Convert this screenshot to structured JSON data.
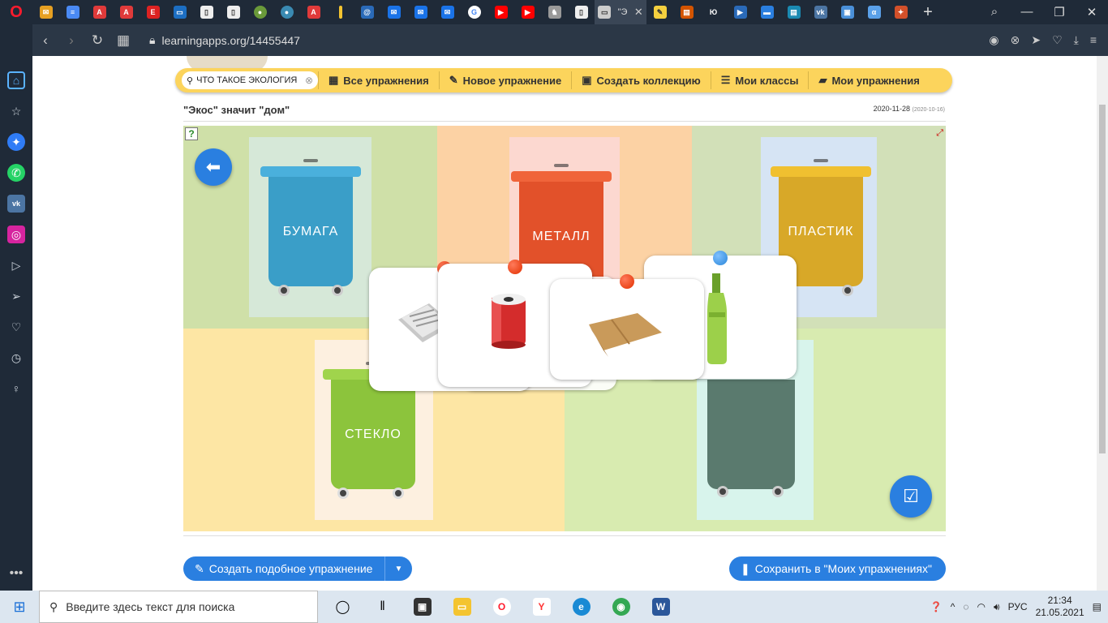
{
  "browser": {
    "active_tab_title": "\"Э",
    "new_tab": "+",
    "url": "learningapps.org/14455447",
    "tab_icons": [
      "opera-mail",
      "docs",
      "pdf",
      "pdf",
      "eduneo",
      "monitor",
      "file",
      "file",
      "globe",
      "globe",
      "pdf",
      "yellow-bar",
      "at",
      "mail",
      "mail",
      "mail",
      "google",
      "youtube",
      "youtube",
      "animal",
      "file"
    ],
    "after_tab_icons": [
      "note",
      "book",
      "lj",
      "media",
      "chat",
      "book",
      "vk",
      "image",
      "alpha",
      "gift"
    ]
  },
  "toolbar": {
    "search_value": "что такое экология",
    "items": [
      "Все упражнения",
      "Новое упражнение",
      "Создать коллекцию",
      "Мои классы",
      "Мои упражнения"
    ]
  },
  "exercise": {
    "title": "\"Экос\" значит \"дом\"",
    "date": "2020-11-28",
    "date_small": "(2020-10-16)",
    "bins": {
      "paper": "БУМАГА",
      "metal": "МЕТАЛЛ",
      "plastic": "ПЛАСТИК",
      "glass": "СТЕКЛО"
    }
  },
  "buttons": {
    "create_similar": "Создать подобное упражнение",
    "save": "Сохранить в \"Моих упражнениях\""
  },
  "taskbar": {
    "search_placeholder": "Введите здесь текст для поиска",
    "lang": "РУС",
    "time": "21:34",
    "date": "21.05.2021"
  },
  "colors": {
    "accent": "#2a7fe0",
    "toolbar": "#fcd45c",
    "bin_paper": "#3a9ec8",
    "bin_metal": "#e2512a",
    "bin_plastic": "#d8a828",
    "bin_glass": "#8cc43c",
    "bin_mixed": "#5a7a6e"
  }
}
